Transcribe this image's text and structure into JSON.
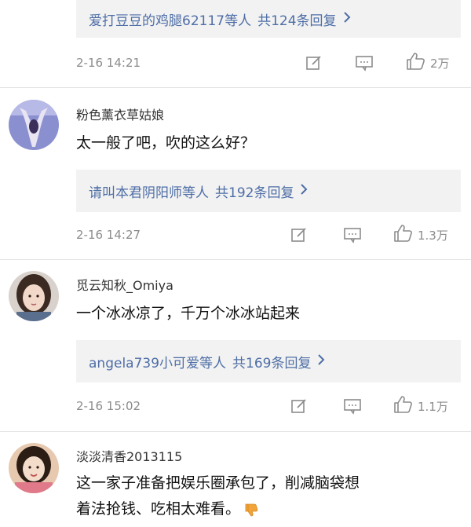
{
  "comments": [
    {
      "reply_summary": {
        "names": "爱打豆豆的鸡腿62117等人",
        "count_text": "共124条回复"
      },
      "time": "2-16 14:21",
      "likes": "2万"
    },
    {
      "username": "粉色薰衣草姑娘",
      "text": "太一般了吧，吹的这么好？",
      "reply_summary": {
        "names": "请叫本君阴阳师等人",
        "count_text": "共192条回复"
      },
      "time": "2-16 14:27",
      "likes": "1.3万",
      "avatar_colors": {
        "bg": "#8a8fd0",
        "figure": "#e8e4f2"
      }
    },
    {
      "username": "觅云知秋_Omiya",
      "text": "一个冰冰凉了，千万个冰冰站起来",
      "reply_summary": {
        "names": "angela739小可爱等人",
        "count_text": "共169条回复"
      },
      "time": "2-16 15:02",
      "likes": "1.1万",
      "avatar_colors": {
        "bg": "#d9d2cc",
        "figure": "#3a2a22"
      }
    },
    {
      "username": "淡淡清香2013115",
      "text_line1": "这一家子准备把娱乐圈承包了，削减脑袋想",
      "text_line2": "着法抢钱、吃相太难看。",
      "avatar_colors": {
        "bg": "#e7c9b0",
        "figure": "#2b1c14"
      }
    }
  ],
  "icons": {
    "edit": "edit-icon",
    "comment": "comment-icon",
    "like": "thumbs-up-icon",
    "emoji": "thumbs-down-emoji-icon"
  },
  "colors": {
    "link": "#4e6ea6",
    "meta": "#8c8c8c",
    "reply_bg": "#f2f2f2",
    "emoji": "#f2a33a"
  }
}
